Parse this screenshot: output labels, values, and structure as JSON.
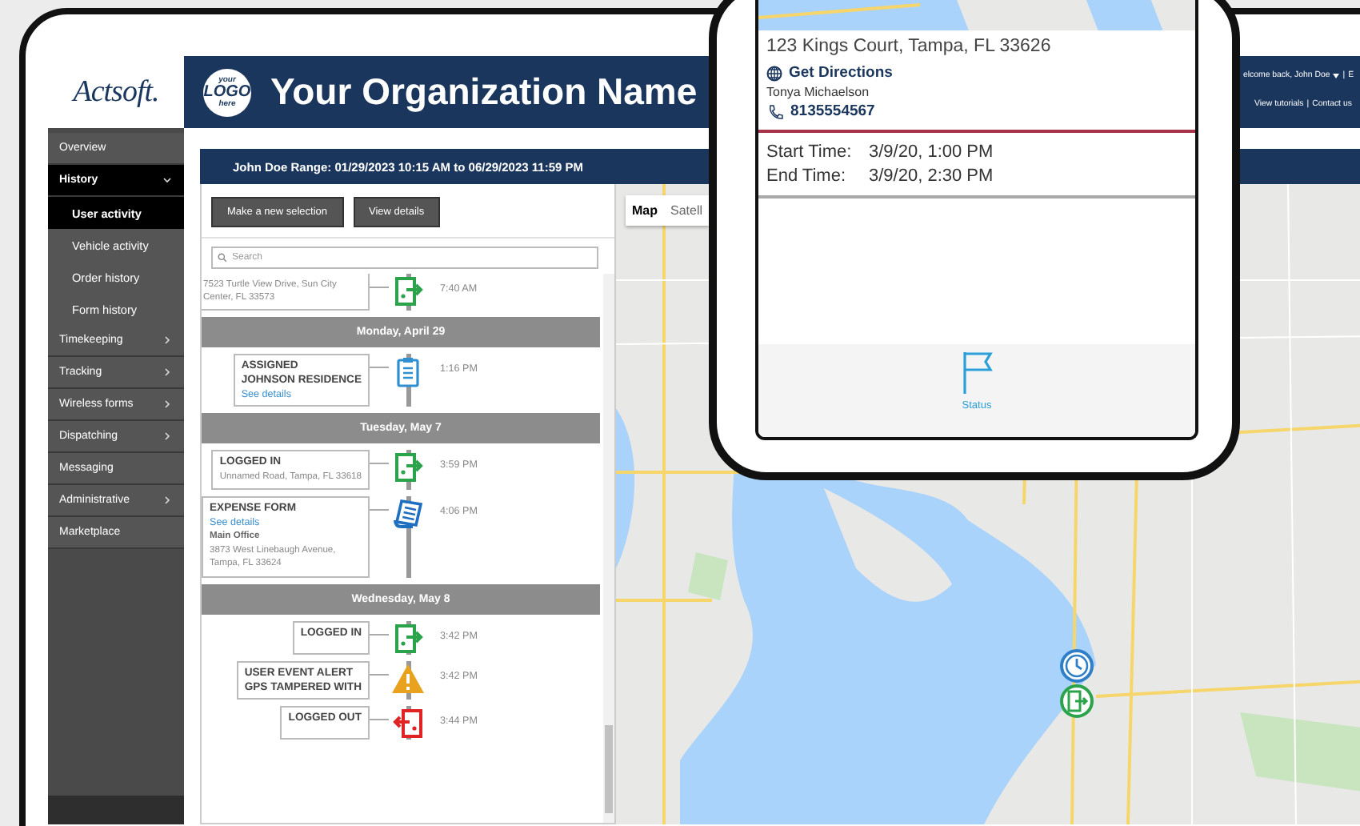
{
  "brand": {
    "name": "Actsoft.",
    "org_logo": [
      "your",
      "LOGO",
      "here"
    ],
    "org_name": "Your Organization Name"
  },
  "user_menu": {
    "greeting": "elcome back, John Doe",
    "separator": "|",
    "cut_link": "E",
    "links": [
      "View tutorials",
      "Contact us"
    ],
    "link_separator": "|"
  },
  "sidebar": {
    "items": [
      {
        "label": "Overview",
        "submenu": false,
        "expanded": false
      },
      {
        "label": "History",
        "submenu": true,
        "expanded": true,
        "children": [
          {
            "label": "User activity",
            "selected": true
          },
          {
            "label": "Vehicle activity",
            "selected": false
          },
          {
            "label": "Order history",
            "selected": false
          },
          {
            "label": "Form history",
            "selected": false
          }
        ]
      },
      {
        "label": "Timekeeping",
        "submenu": true,
        "expanded": false
      },
      {
        "label": "Tracking",
        "submenu": true,
        "expanded": false
      },
      {
        "label": "Wireless forms",
        "submenu": true,
        "expanded": false
      },
      {
        "label": "Dispatching",
        "submenu": true,
        "expanded": false
      },
      {
        "label": "Messaging",
        "submenu": false,
        "expanded": false
      },
      {
        "label": "Administrative",
        "submenu": true,
        "expanded": false
      },
      {
        "label": "Marketplace",
        "submenu": false,
        "expanded": false
      }
    ]
  },
  "panel": {
    "title": "John Doe Range: 01/29/2023  10:15 AM to 06/29/2023 11:59 PM",
    "buttons": [
      "Make a new selection",
      "View details"
    ],
    "search": {
      "placeholder": "Search"
    },
    "timeline": [
      {
        "kind": "login",
        "cut": true,
        "lines": [
          "7523 Turtle View Drive, Sun City Center, FL 33573"
        ],
        "time": "7:40 AM"
      },
      {
        "kind": "day",
        "label": "Monday, April 29"
      },
      {
        "kind": "assignment",
        "cut": false,
        "titles": [
          "ASSIGNED",
          "JOHNSON RESIDENCE"
        ],
        "link": "See details",
        "time": "1:16 PM"
      },
      {
        "kind": "day",
        "label": "Tuesday, May 7"
      },
      {
        "kind": "login",
        "cut": false,
        "titles": [
          "LOGGED IN"
        ],
        "lines": [
          "Unnamed Road, Tampa, FL 33618"
        ],
        "time": "3:59 PM"
      },
      {
        "kind": "form",
        "cut": false,
        "titles": [
          "EXPENSE FORM"
        ],
        "link": "See details",
        "place": "Main Office",
        "lines": [
          "3873 West Linebaugh Avenue, Tampa, FL 33624"
        ],
        "time": "4:06 PM"
      },
      {
        "kind": "day",
        "label": "Wednesday, May 8"
      },
      {
        "kind": "login",
        "cut": false,
        "titles": [
          "LOGGED IN"
        ],
        "time": "3:42 PM"
      },
      {
        "kind": "alert",
        "cut": false,
        "titles": [
          "USER EVENT ALERT",
          "GPS TAMPERED WITH"
        ],
        "time": "3:42 PM"
      },
      {
        "kind": "logout",
        "cut": false,
        "titles": [
          "LOGGED OUT"
        ],
        "time": "3:44 PM"
      }
    ]
  },
  "map": {
    "types": [
      {
        "label": "Map",
        "selected": true
      },
      {
        "label": "Satell",
        "selected": false
      }
    ],
    "markers": [
      {
        "kind": "clock"
      },
      {
        "kind": "login"
      }
    ]
  },
  "phone": {
    "address": "123 Kings Court, Tampa, FL 33626",
    "directions": "Get Directions",
    "contact": "Tonya Michaelson",
    "phone": "8135554567",
    "times": [
      {
        "label": "Start Time:",
        "value": "3/9/20, 1:00 PM"
      },
      {
        "label": "End Time:",
        "value": "3/9/20, 2:30 PM"
      }
    ],
    "tab_bar": [
      {
        "label": "Status",
        "selected": true
      }
    ]
  }
}
